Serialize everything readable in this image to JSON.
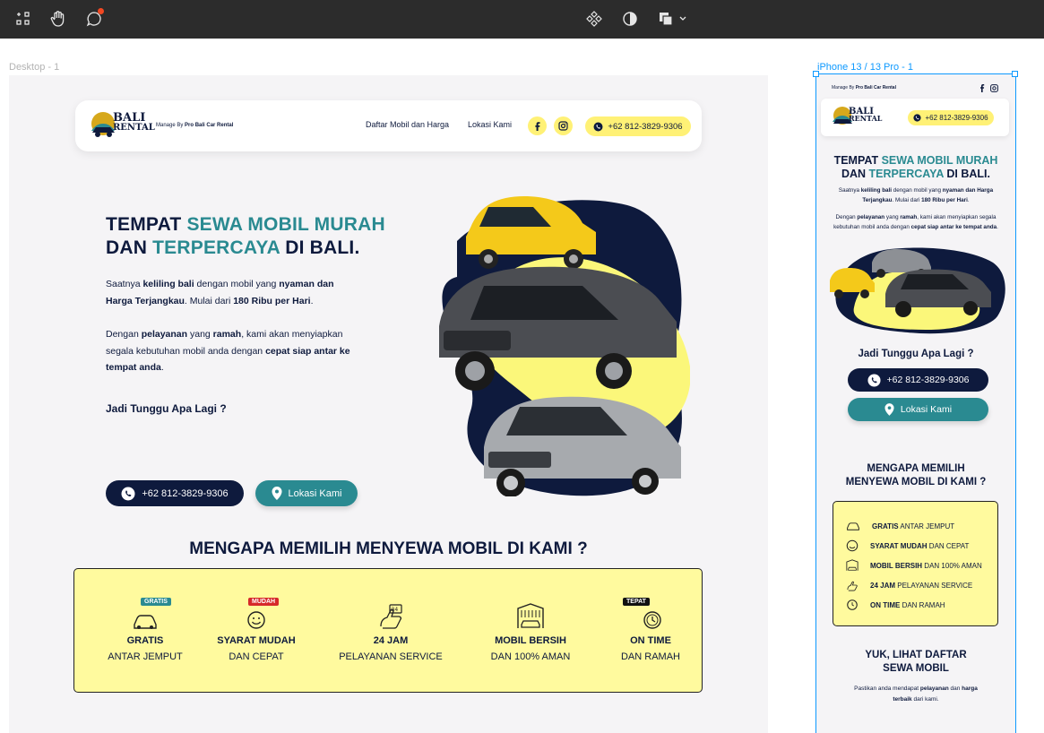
{
  "colors": {
    "navy": "#0e1a3d",
    "teal": "#2a8a91",
    "yellow": "#fff176",
    "pale_yellow": "#fffa9e",
    "selection": "#0d99ff"
  },
  "toolbar": {
    "icons": [
      "frame-tool-icon",
      "hand-tool-icon",
      "comment-icon",
      "components-icon",
      "contrast-icon",
      "layers-dropdown-icon"
    ]
  },
  "frames": {
    "desktop_label": "Desktop - 1",
    "mobile_label": "iPhone 13 / 13 Pro - 1"
  },
  "brand": {
    "logo_line1": "BALI",
    "logo_line2": "RENTAL",
    "manage_prefix": "Manage By ",
    "manage_name": "Pro Bali Car Rental"
  },
  "nav": {
    "link1": "Daftar Mobil dan Harga",
    "link2": "Lokasi Kami",
    "phone": "+62 812-3829-9306"
  },
  "hero": {
    "t1_a": "TEMPAT ",
    "t1_b": "SEWA MOBIL MURAH",
    "t2_a": "DAN ",
    "t2_b": "TERPERCAYA",
    "t2_c": " DI BALI.",
    "p1": [
      "Saatnya ",
      "keliling bali",
      " dengan mobil yang ",
      "nyaman dan",
      "Harga Terjangkau",
      ". Mulai dari ",
      "180 Ribu per Hari",
      "."
    ],
    "p2": [
      "Dengan ",
      "pelayanan",
      " yang ",
      "ramah",
      ", kami akan menyiapkan",
      "segala kebutuhan mobil anda dengan ",
      "cepat siap antar ke",
      "tempat anda",
      "."
    ],
    "question": "Jadi Tunggu Apa Lagi ?",
    "btn_phone": "+62 812-3829-9306",
    "btn_location": "Lokasi Kami"
  },
  "why": {
    "title": "MENGAPA MEMILIH MENYEWA MOBIL DI KAMI ?",
    "mobile_title_1": "MENGAPA MEMILIH",
    "mobile_title_2": "MENYEWA MOBIL DI KAMI ?",
    "features": [
      {
        "title": "GRATIS",
        "sub": "ANTAR JEMPUT",
        "tag": "GRATIS",
        "icon": "car-icon"
      },
      {
        "title": "SYARAT MUDAH",
        "sub": "DAN CEPAT",
        "tag": "MUDAH",
        "icon": "smile-icon"
      },
      {
        "title": "24 JAM",
        "sub": "PELAYANAN SERVICE",
        "tag": "",
        "icon": "24h-service-icon"
      },
      {
        "title": "MOBIL BERSIH",
        "sub": "DAN 100% AMAN",
        "tag": "",
        "icon": "car-wash-icon"
      },
      {
        "title": "ON TIME",
        "sub": "DAN RAMAH",
        "tag": "TEPAT",
        "icon": "clock-icon"
      }
    ],
    "mobile_features": [
      {
        "bold": "GRATIS",
        "rest": "  ANTAR JEMPUT"
      },
      {
        "bold": "SYARAT MUDAH",
        "rest": " DAN CEPAT"
      },
      {
        "bold": "MOBIL BERSIH",
        "rest": " DAN 100% AMAN"
      },
      {
        "bold": "24 JAM",
        "rest": " PELAYANAN SERVICE"
      },
      {
        "bold": "ON TIME",
        "rest": " DAN RAMAH"
      }
    ]
  },
  "mobile": {
    "p1": [
      "Saatnya ",
      "keliling bali",
      " dengan mobil yang ",
      "nyaman dan Harga",
      "Terjangkau",
      ". Mulai dari ",
      "180 Ribu per Hari",
      "."
    ],
    "p2": [
      "Dengan ",
      "pelayanan",
      " yang ",
      "ramah",
      ", kami akan menyiapkan segala",
      "kebutuhan mobil anda dengan ",
      "cepat siap antar ke tempat anda",
      "."
    ],
    "list_title_1": "YUK, LIHAT DAFTAR",
    "list_title_2": "SEWA MOBIL",
    "list_p": [
      "Pastikan anda mendapat ",
      "pelayanan",
      " dan ",
      "harga",
      "terbaik",
      " dari kami."
    ]
  }
}
